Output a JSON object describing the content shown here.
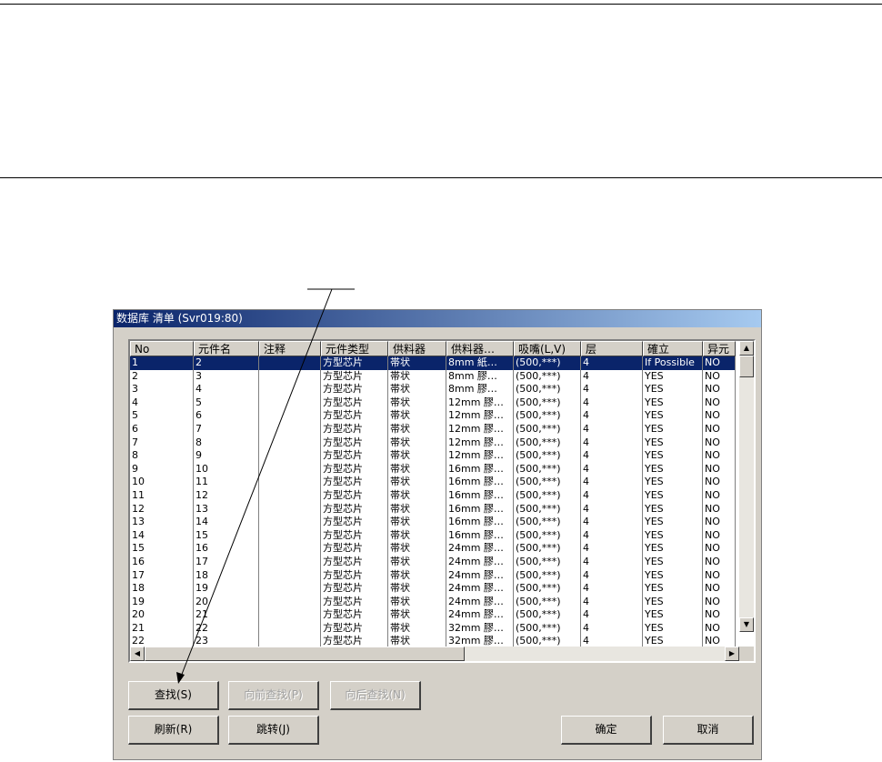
{
  "dialog": {
    "title": "数据库 清单 (Svr019:80)"
  },
  "table": {
    "columns": [
      "No",
      "元件名",
      "注释",
      "元件类型",
      "供料器",
      "供料器…",
      "吸嘴(L,V)",
      "层",
      "確立",
      "异元"
    ],
    "rows": [
      [
        "1",
        "2",
        "",
        "方型芯片",
        "帯状",
        "8mm 紙…",
        "(500,***)",
        "4",
        "If Possible",
        "NO"
      ],
      [
        "2",
        "3",
        "",
        "方型芯片",
        "帯状",
        "8mm 膠…",
        "(500,***)",
        "4",
        "YES",
        "NO"
      ],
      [
        "3",
        "4",
        "",
        "方型芯片",
        "帯状",
        "8mm 膠…",
        "(500,***)",
        "4",
        "YES",
        "NO"
      ],
      [
        "4",
        "5",
        "",
        "方型芯片",
        "帯状",
        "12mm 膠…",
        "(500,***)",
        "4",
        "YES",
        "NO"
      ],
      [
        "5",
        "6",
        "",
        "方型芯片",
        "帯状",
        "12mm 膠…",
        "(500,***)",
        "4",
        "YES",
        "NO"
      ],
      [
        "6",
        "7",
        "",
        "方型芯片",
        "帯状",
        "12mm 膠…",
        "(500,***)",
        "4",
        "YES",
        "NO"
      ],
      [
        "7",
        "8",
        "",
        "方型芯片",
        "帯状",
        "12mm 膠…",
        "(500,***)",
        "4",
        "YES",
        "NO"
      ],
      [
        "8",
        "9",
        "",
        "方型芯片",
        "帯状",
        "12mm 膠…",
        "(500,***)",
        "4",
        "YES",
        "NO"
      ],
      [
        "9",
        "10",
        "",
        "方型芯片",
        "帯状",
        "16mm 膠…",
        "(500,***)",
        "4",
        "YES",
        "NO"
      ],
      [
        "10",
        "11",
        "",
        "方型芯片",
        "帯状",
        "16mm 膠…",
        "(500,***)",
        "4",
        "YES",
        "NO"
      ],
      [
        "11",
        "12",
        "",
        "方型芯片",
        "帯状",
        "16mm 膠…",
        "(500,***)",
        "4",
        "YES",
        "NO"
      ],
      [
        "12",
        "13",
        "",
        "方型芯片",
        "帯状",
        "16mm 膠…",
        "(500,***)",
        "4",
        "YES",
        "NO"
      ],
      [
        "13",
        "14",
        "",
        "方型芯片",
        "帯状",
        "16mm 膠…",
        "(500,***)",
        "4",
        "YES",
        "NO"
      ],
      [
        "14",
        "15",
        "",
        "方型芯片",
        "帯状",
        "16mm 膠…",
        "(500,***)",
        "4",
        "YES",
        "NO"
      ],
      [
        "15",
        "16",
        "",
        "方型芯片",
        "帯状",
        "24mm 膠…",
        "(500,***)",
        "4",
        "YES",
        "NO"
      ],
      [
        "16",
        "17",
        "",
        "方型芯片",
        "帯状",
        "24mm 膠…",
        "(500,***)",
        "4",
        "YES",
        "NO"
      ],
      [
        "17",
        "18",
        "",
        "方型芯片",
        "帯状",
        "24mm 膠…",
        "(500,***)",
        "4",
        "YES",
        "NO"
      ],
      [
        "18",
        "19",
        "",
        "方型芯片",
        "帯状",
        "24mm 膠…",
        "(500,***)",
        "4",
        "YES",
        "NO"
      ],
      [
        "19",
        "20",
        "",
        "方型芯片",
        "帯状",
        "24mm 膠…",
        "(500,***)",
        "4",
        "YES",
        "NO"
      ],
      [
        "20",
        "21",
        "",
        "方型芯片",
        "帯状",
        "24mm 膠…",
        "(500,***)",
        "4",
        "YES",
        "NO"
      ],
      [
        "21",
        "22",
        "",
        "方型芯片",
        "帯状",
        "32mm 膠…",
        "(500,***)",
        "4",
        "YES",
        "NO"
      ],
      [
        "22",
        "23",
        "",
        "方型芯片",
        "帯状",
        "32mm 膠…",
        "(500,***)",
        "4",
        "YES",
        "NO"
      ]
    ],
    "selected_row": 0
  },
  "buttons": {
    "find": "查找(S)",
    "find_prev": "向前查找(P)",
    "find_next": "向后查找(N)",
    "refresh": "刷新(R)",
    "jump": "跳转(J)",
    "ok": "确定",
    "cancel": "取消"
  },
  "icons": {
    "scroll_up": "scroll-up-arrow-icon",
    "scroll_down": "scroll-down-arrow-icon",
    "scroll_left": "scroll-left-arrow-icon",
    "scroll_right": "scroll-right-arrow-icon",
    "callout_arrow": "callout-arrow-icon"
  }
}
